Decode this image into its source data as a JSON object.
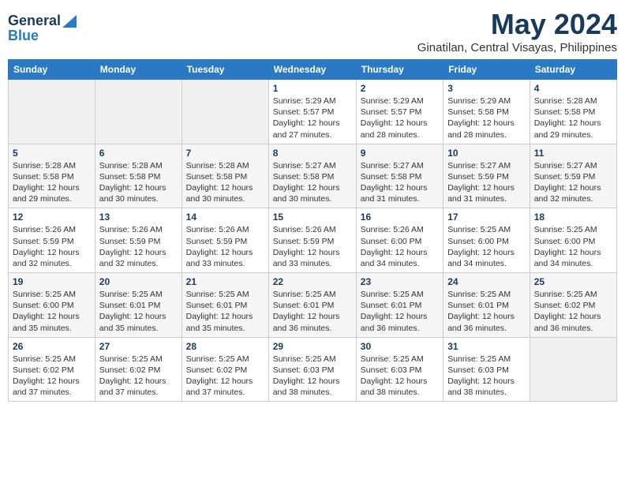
{
  "logo": {
    "general": "General",
    "blue": "Blue"
  },
  "header": {
    "month": "May 2024",
    "location": "Ginatilan, Central Visayas, Philippines"
  },
  "days_of_week": [
    "Sunday",
    "Monday",
    "Tuesday",
    "Wednesday",
    "Thursday",
    "Friday",
    "Saturday"
  ],
  "weeks": [
    [
      {
        "day": "",
        "content": ""
      },
      {
        "day": "",
        "content": ""
      },
      {
        "day": "",
        "content": ""
      },
      {
        "day": "1",
        "content": "Sunrise: 5:29 AM\nSunset: 5:57 PM\nDaylight: 12 hours and 27 minutes."
      },
      {
        "day": "2",
        "content": "Sunrise: 5:29 AM\nSunset: 5:57 PM\nDaylight: 12 hours and 28 minutes."
      },
      {
        "day": "3",
        "content": "Sunrise: 5:29 AM\nSunset: 5:58 PM\nDaylight: 12 hours and 28 minutes."
      },
      {
        "day": "4",
        "content": "Sunrise: 5:28 AM\nSunset: 5:58 PM\nDaylight: 12 hours and 29 minutes."
      }
    ],
    [
      {
        "day": "5",
        "content": "Sunrise: 5:28 AM\nSunset: 5:58 PM\nDaylight: 12 hours and 29 minutes."
      },
      {
        "day": "6",
        "content": "Sunrise: 5:28 AM\nSunset: 5:58 PM\nDaylight: 12 hours and 30 minutes."
      },
      {
        "day": "7",
        "content": "Sunrise: 5:28 AM\nSunset: 5:58 PM\nDaylight: 12 hours and 30 minutes."
      },
      {
        "day": "8",
        "content": "Sunrise: 5:27 AM\nSunset: 5:58 PM\nDaylight: 12 hours and 30 minutes."
      },
      {
        "day": "9",
        "content": "Sunrise: 5:27 AM\nSunset: 5:58 PM\nDaylight: 12 hours and 31 minutes."
      },
      {
        "day": "10",
        "content": "Sunrise: 5:27 AM\nSunset: 5:59 PM\nDaylight: 12 hours and 31 minutes."
      },
      {
        "day": "11",
        "content": "Sunrise: 5:27 AM\nSunset: 5:59 PM\nDaylight: 12 hours and 32 minutes."
      }
    ],
    [
      {
        "day": "12",
        "content": "Sunrise: 5:26 AM\nSunset: 5:59 PM\nDaylight: 12 hours and 32 minutes."
      },
      {
        "day": "13",
        "content": "Sunrise: 5:26 AM\nSunset: 5:59 PM\nDaylight: 12 hours and 32 minutes."
      },
      {
        "day": "14",
        "content": "Sunrise: 5:26 AM\nSunset: 5:59 PM\nDaylight: 12 hours and 33 minutes."
      },
      {
        "day": "15",
        "content": "Sunrise: 5:26 AM\nSunset: 5:59 PM\nDaylight: 12 hours and 33 minutes."
      },
      {
        "day": "16",
        "content": "Sunrise: 5:26 AM\nSunset: 6:00 PM\nDaylight: 12 hours and 34 minutes."
      },
      {
        "day": "17",
        "content": "Sunrise: 5:25 AM\nSunset: 6:00 PM\nDaylight: 12 hours and 34 minutes."
      },
      {
        "day": "18",
        "content": "Sunrise: 5:25 AM\nSunset: 6:00 PM\nDaylight: 12 hours and 34 minutes."
      }
    ],
    [
      {
        "day": "19",
        "content": "Sunrise: 5:25 AM\nSunset: 6:00 PM\nDaylight: 12 hours and 35 minutes."
      },
      {
        "day": "20",
        "content": "Sunrise: 5:25 AM\nSunset: 6:01 PM\nDaylight: 12 hours and 35 minutes."
      },
      {
        "day": "21",
        "content": "Sunrise: 5:25 AM\nSunset: 6:01 PM\nDaylight: 12 hours and 35 minutes."
      },
      {
        "day": "22",
        "content": "Sunrise: 5:25 AM\nSunset: 6:01 PM\nDaylight: 12 hours and 36 minutes."
      },
      {
        "day": "23",
        "content": "Sunrise: 5:25 AM\nSunset: 6:01 PM\nDaylight: 12 hours and 36 minutes."
      },
      {
        "day": "24",
        "content": "Sunrise: 5:25 AM\nSunset: 6:01 PM\nDaylight: 12 hours and 36 minutes."
      },
      {
        "day": "25",
        "content": "Sunrise: 5:25 AM\nSunset: 6:02 PM\nDaylight: 12 hours and 36 minutes."
      }
    ],
    [
      {
        "day": "26",
        "content": "Sunrise: 5:25 AM\nSunset: 6:02 PM\nDaylight: 12 hours and 37 minutes."
      },
      {
        "day": "27",
        "content": "Sunrise: 5:25 AM\nSunset: 6:02 PM\nDaylight: 12 hours and 37 minutes."
      },
      {
        "day": "28",
        "content": "Sunrise: 5:25 AM\nSunset: 6:02 PM\nDaylight: 12 hours and 37 minutes."
      },
      {
        "day": "29",
        "content": "Sunrise: 5:25 AM\nSunset: 6:03 PM\nDaylight: 12 hours and 38 minutes."
      },
      {
        "day": "30",
        "content": "Sunrise: 5:25 AM\nSunset: 6:03 PM\nDaylight: 12 hours and 38 minutes."
      },
      {
        "day": "31",
        "content": "Sunrise: 5:25 AM\nSunset: 6:03 PM\nDaylight: 12 hours and 38 minutes."
      },
      {
        "day": "",
        "content": ""
      }
    ]
  ]
}
